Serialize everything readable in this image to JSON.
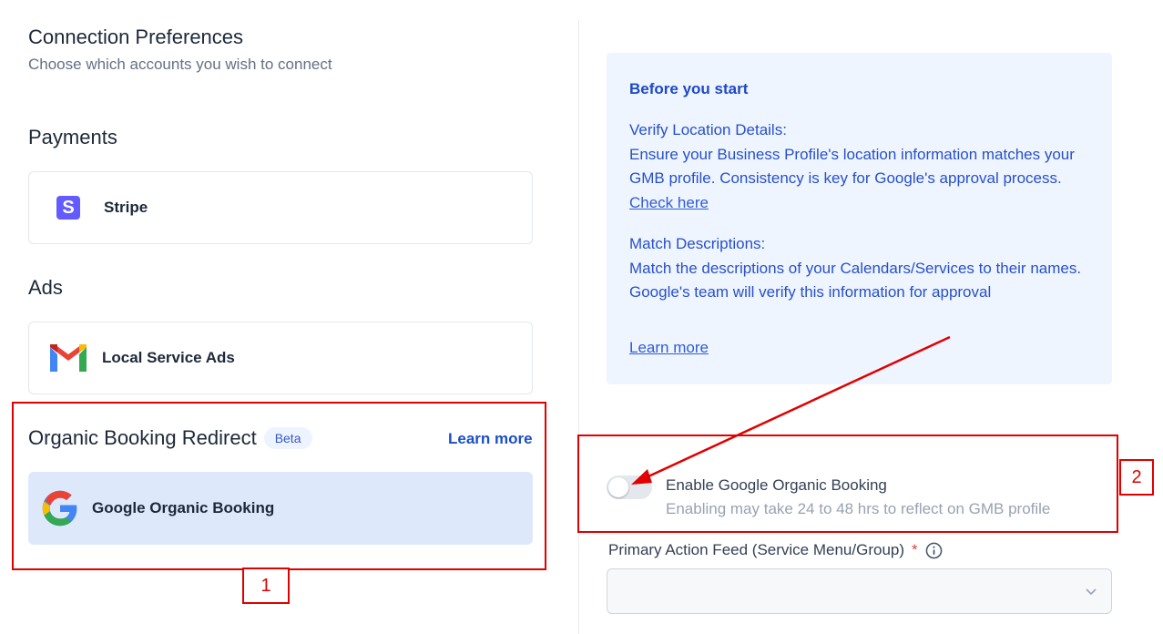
{
  "header": {
    "title": "Connection Preferences",
    "subtitle": "Choose which accounts you wish to connect"
  },
  "payments": {
    "title": "Payments",
    "stripe_label": "Stripe"
  },
  "ads": {
    "title": "Ads",
    "lsa_label": "Local Service Ads"
  },
  "organic": {
    "title": "Organic Booking Redirect",
    "badge": "Beta",
    "learn_more": "Learn more",
    "google_label": "Google Organic Booking"
  },
  "annotations": {
    "label_1": "1",
    "label_2": "2"
  },
  "info": {
    "heading": "Before you start",
    "verify_title": "Verify Location Details:",
    "verify_text": "Ensure your Business Profile's location information matches your GMB profile. Consistency is key for Google's approval process.",
    "check_here": "Check here",
    "match_title": "Match Descriptions:",
    "match_text": "Match the descriptions of your Calendars/Services to their names. Google's team will verify this information for approval",
    "learn_more": "Learn more"
  },
  "toggle": {
    "label": "Enable Google Organic Booking",
    "hint": "Enabling may take 24 to 48 hrs to reflect on GMB profile",
    "enabled": false
  },
  "feed": {
    "label": "Primary Action Feed (Service Menu/Group)",
    "required_mark": "*",
    "value": ""
  },
  "colors": {
    "annotation_red": "#e00000",
    "link_blue": "#1a4fc9",
    "info_bg": "#eff5ff",
    "google_card_bg": "#dde9fb"
  }
}
